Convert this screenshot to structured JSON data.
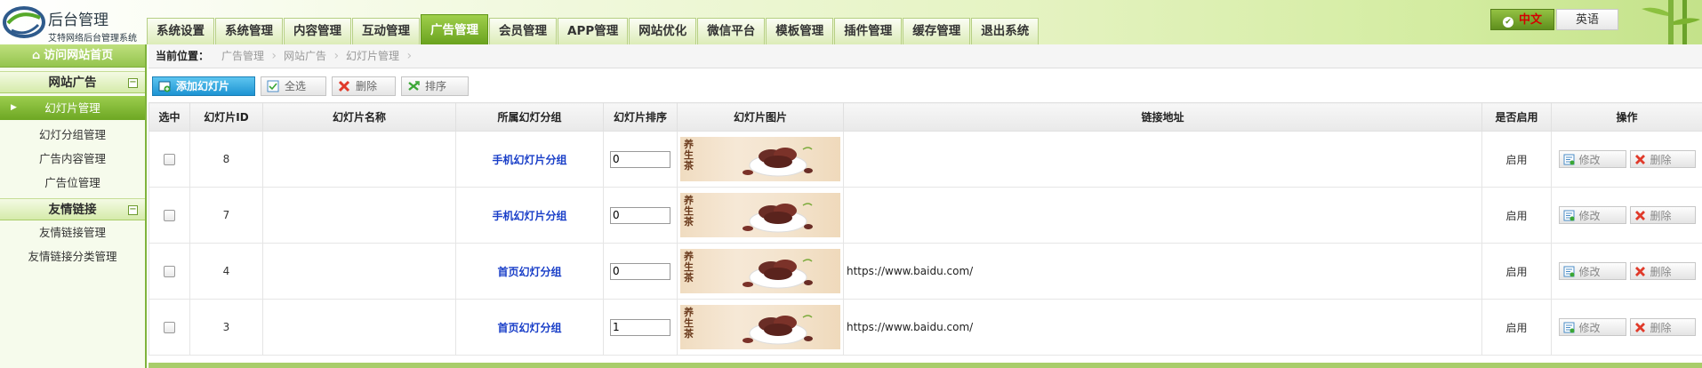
{
  "header": {
    "title": "后台管理",
    "subtitle": "艾特网络后台管理系统",
    "nav": [
      "系统设置",
      "系统管理",
      "内容管理",
      "互动管理",
      "广告管理",
      "会员管理",
      "APP管理",
      "网站优化",
      "微信平台",
      "模板管理",
      "插件管理",
      "缓存管理",
      "退出系统"
    ],
    "active_nav": "广告管理",
    "lang_zh": "中文",
    "lang_en": "英语"
  },
  "sidebar": {
    "home": "访问网站首页",
    "groups": [
      {
        "title": "网站广告",
        "toggle": "−",
        "items": [
          "幻灯片管理",
          "幻灯分组管理",
          "广告内容管理",
          "广告位管理"
        ]
      },
      {
        "title": "友情链接",
        "toggle": "−",
        "items": [
          "友情链接管理",
          "友情链接分类管理"
        ]
      }
    ],
    "active_item": "幻灯片管理"
  },
  "breadcrumb": {
    "label": "当前位置：",
    "items": [
      "广告管理",
      "网站广告",
      "幻灯片管理"
    ]
  },
  "toolbar": {
    "add": "添加幻灯片",
    "select_all": "全选",
    "delete": "删除",
    "sort": "排序"
  },
  "table": {
    "headers": [
      "选中",
      "幻灯片ID",
      "幻灯片名称",
      "所属幻灯分组",
      "幻灯片排序",
      "幻灯片图片",
      "链接地址",
      "是否启用",
      "操作"
    ],
    "rows": [
      {
        "id": "8",
        "name": "",
        "group": "手机幻灯片分组",
        "sort": "0",
        "url": "",
        "enabled": "启用"
      },
      {
        "id": "7",
        "name": "",
        "group": "手机幻灯片分组",
        "sort": "0",
        "url": "",
        "enabled": "启用"
      },
      {
        "id": "4",
        "name": "",
        "group": "首页幻灯分组",
        "sort": "0",
        "url": "https://www.baidu.com/",
        "enabled": "启用"
      },
      {
        "id": "3",
        "name": "",
        "group": "首页幻灯分组",
        "sort": "1",
        "url": "https://www.baidu.com/",
        "enabled": "启用"
      }
    ],
    "edit_label": "修改",
    "delete_label": "删除",
    "thumb_text": "养\n生\n茶"
  },
  "colors": {
    "accent_green": "#6da723",
    "primary_blue": "#1d93d2",
    "link_blue": "#1a3fc8",
    "zh_red": "#d40000"
  }
}
